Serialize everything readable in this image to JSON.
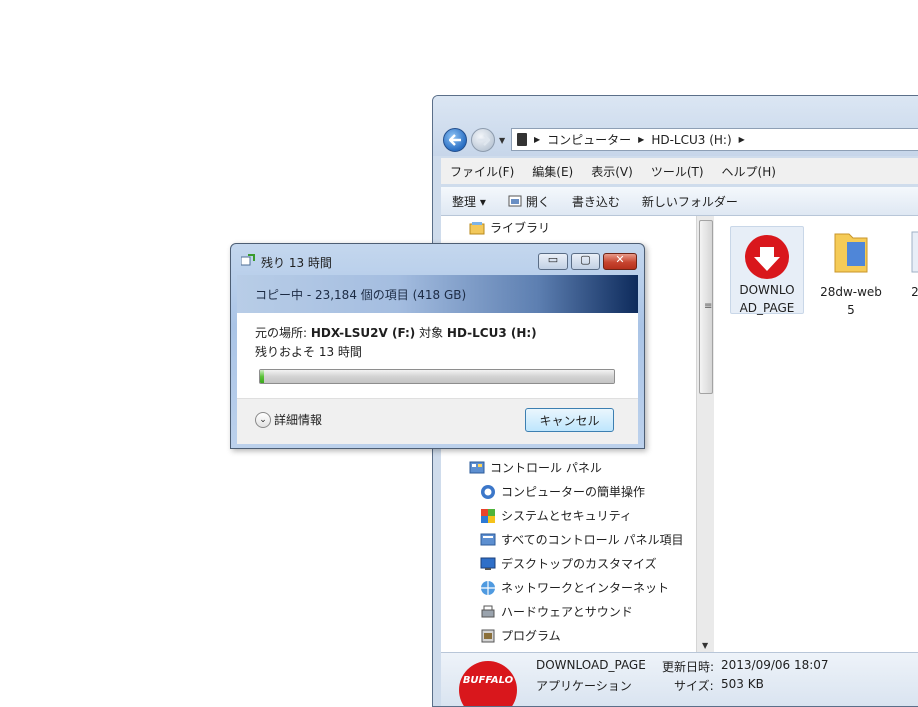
{
  "explorer": {
    "breadcrumb": [
      "コンピューター",
      "HD-LCU3 (H:)"
    ],
    "menu": [
      "ファイル(F)",
      "編集(E)",
      "表示(V)",
      "ツール(T)",
      "ヘルプ(H)"
    ],
    "toolbar": {
      "organize": "整理 ▾",
      "open": "開く",
      "burn": "書き込む",
      "new_folder": "新しいフォルダー"
    },
    "nav": {
      "library": "ライブラリ",
      "control_panel": "コントロール パネル",
      "items": [
        "コンピューターの簡単操作",
        "システムとセキュリティ",
        "すべてのコントロール パネル項目",
        "デスクトップのカスタマイズ",
        "ネットワークとインターネット",
        "ハードウェアとサウンド",
        "プログラム"
      ]
    },
    "files": [
      {
        "name": "DOWNLO\nAD_PAGE",
        "icon": "buffalo-download-icon"
      },
      {
        "name": "28dw-web\n5",
        "icon": "folder-icon"
      },
      {
        "name": "2",
        "icon": "file-icon"
      }
    ],
    "details": {
      "name": "DOWNLOAD_PAGE",
      "type": "アプリケーション",
      "modified_label": "更新日時:",
      "modified_value": "2013/09/06 18:07",
      "size_label": "サイズ:",
      "size_value": "503 KB",
      "logo_text": "BUFFALO"
    }
  },
  "dialog": {
    "title": "残り 13 時間",
    "header": "コピー中 - 23,184 個の項目 (418 GB)",
    "source_label": "元の場所: ",
    "source_value": "HDX-LSU2V (F:)",
    "target_label": " 対象 ",
    "target_value": "HD-LCU3 (H:)",
    "remaining": "残りおよそ 13 時間",
    "progress_fraction": 0.01,
    "details_label": "詳細情報",
    "cancel_label": "キャンセル"
  }
}
